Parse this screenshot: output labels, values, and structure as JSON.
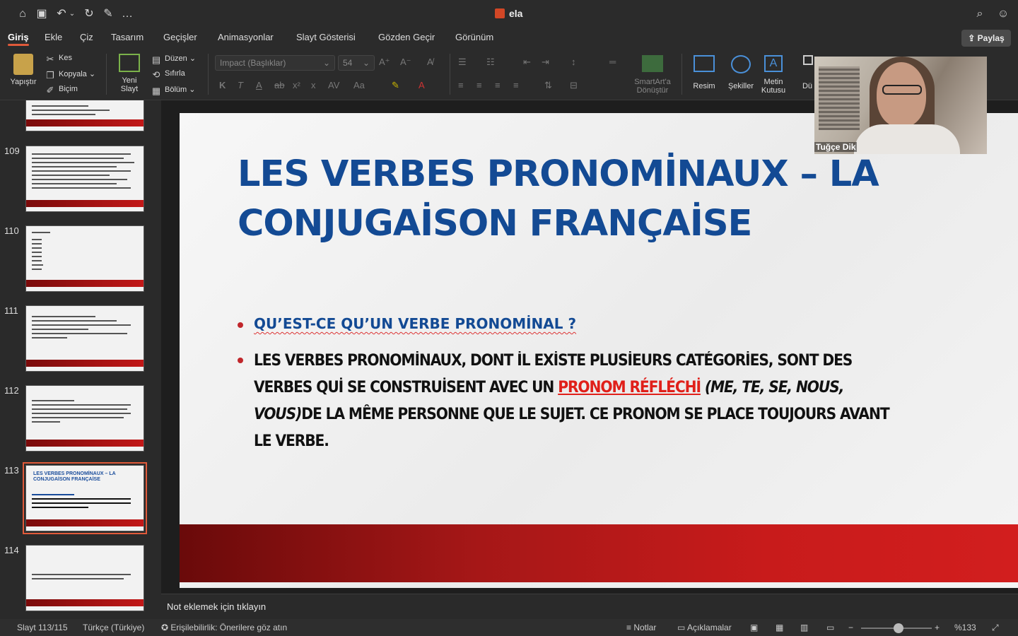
{
  "window": {
    "title": "ela"
  },
  "menu_tabs": [
    "Giriş",
    "Ekle",
    "Çiz",
    "Tasarım",
    "Geçişler",
    "Animasyonlar",
    "Slayt Gösterisi",
    "Gözden Geçir",
    "Görünüm"
  ],
  "share_label": "Paylaş",
  "ribbon": {
    "paste": "Yapıştır",
    "cut": "Kes",
    "copy": "Kopyala",
    "format": "Biçim",
    "new_slide_1": "Yeni",
    "new_slide_2": "Slayt",
    "layout": "Düzen",
    "reset": "Sıfırla",
    "section": "Bölüm",
    "font_name": "Impact (Başlıklar)",
    "font_size": "54",
    "smartart_1": "SmartArt'a",
    "smartart_2": "Dönüştür",
    "picture": "Resim",
    "shapes": "Şekiller",
    "textbox_1": "Metin",
    "textbox_2": "Kutusu",
    "arrange_partial": "Dü"
  },
  "thumbnails": [
    {
      "num": "109"
    },
    {
      "num": "110"
    },
    {
      "num": "111"
    },
    {
      "num": "112"
    },
    {
      "num": "113",
      "title": "LES VERBES PRONOMİNAUX – LA CONJUGAİSON FRANÇAİSE"
    },
    {
      "num": "114"
    }
  ],
  "slide": {
    "title": "LES VERBES PRONOMİNAUX – LA CONJUGAİSON FRANÇAİSE",
    "bullet1": "QU’EST-CE QU’UN VERBE PRONOMİNAL ?",
    "bullet2_a": "LES VERBES PRONOMİNAUX, DONT İL EXİSTE PLUSİEURS CATÉGORİES, SONT DES VERBES QUİ SE CONSTRUİSENT AVEC UN ",
    "bullet2_red": "PRONOM RÉFLÉCHİ",
    "bullet2_italic": " (ME, TE, SE, NOUS, VOUS)",
    "bullet2_b": "DE LA MÊME PERSONNE QUE LE SUJET. CE PRONOM SE PLACE TOUJOURS AVANT LE VERBE."
  },
  "notes_placeholder": "Not eklemek için tıklayın",
  "status": {
    "slide_counter": "Slayt 113/115",
    "language": "Türkçe (Türkiye)",
    "accessibility": "Erişilebilirlik: Önerilere göz atın",
    "notes": "Notlar",
    "comments": "Açıklamalar",
    "zoom": "%133"
  },
  "video": {
    "participant": "Tuğçe Dik"
  },
  "colors": {
    "accent": "#e05a3a",
    "title_blue": "#134a94",
    "band_red": "#c81b1b"
  }
}
